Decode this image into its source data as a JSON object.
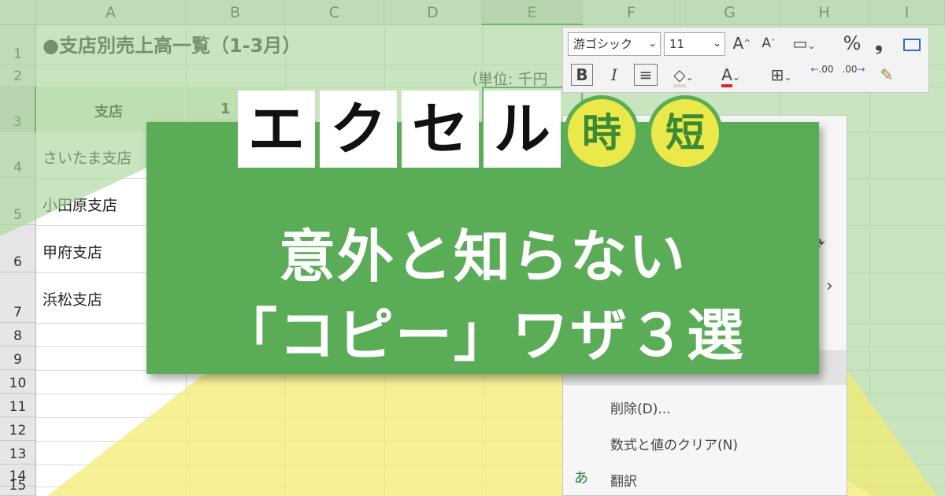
{
  "spreadsheet": {
    "columns": [
      "A",
      "B",
      "C",
      "D",
      "E",
      "F",
      "G",
      "H",
      "I"
    ],
    "selected_column": "E",
    "rows": [
      "1",
      "2",
      "3",
      "4",
      "5",
      "6",
      "7",
      "8",
      "9",
      "10",
      "11",
      "12",
      "13",
      "14",
      "15"
    ],
    "selected_row": "3",
    "title": "●支店別売上高一覧（1-3月）",
    "unit": "（単位: 千円",
    "header_branch": "支店",
    "header_partial": "1",
    "branches": [
      "さいたま支店",
      "小田原支店",
      "甲府支店",
      "浜松支店"
    ]
  },
  "mini_toolbar": {
    "font_name": "游ゴシック",
    "font_size": "11",
    "grow_font": "A",
    "shrink_font": "A",
    "percent": "%",
    "comma": "❟",
    "bold": "B",
    "italic": "I",
    "dec_increase": ".00",
    "dec_decrease": ".00"
  },
  "context_menu": {
    "items": [
      {
        "label": "削除(D)..."
      },
      {
        "label": "数式と値のクリア(N)"
      },
      {
        "label": "翻訳",
        "icon": "あ"
      }
    ],
    "submenu_arrow": "›"
  },
  "banner": {
    "katakana": [
      "エ",
      "ク",
      "セ",
      "ル"
    ],
    "kanji": [
      "時",
      "短"
    ],
    "line1": "意外と知らない",
    "line2": "「コピー」ワザ３選"
  },
  "colors": {
    "banner_green": "#5aac57",
    "overlay_green": "#a8d59a",
    "overlay_yellow": "#f2ec6e",
    "circle_yellow": "#ebe84a",
    "excel_green": "#217346"
  }
}
